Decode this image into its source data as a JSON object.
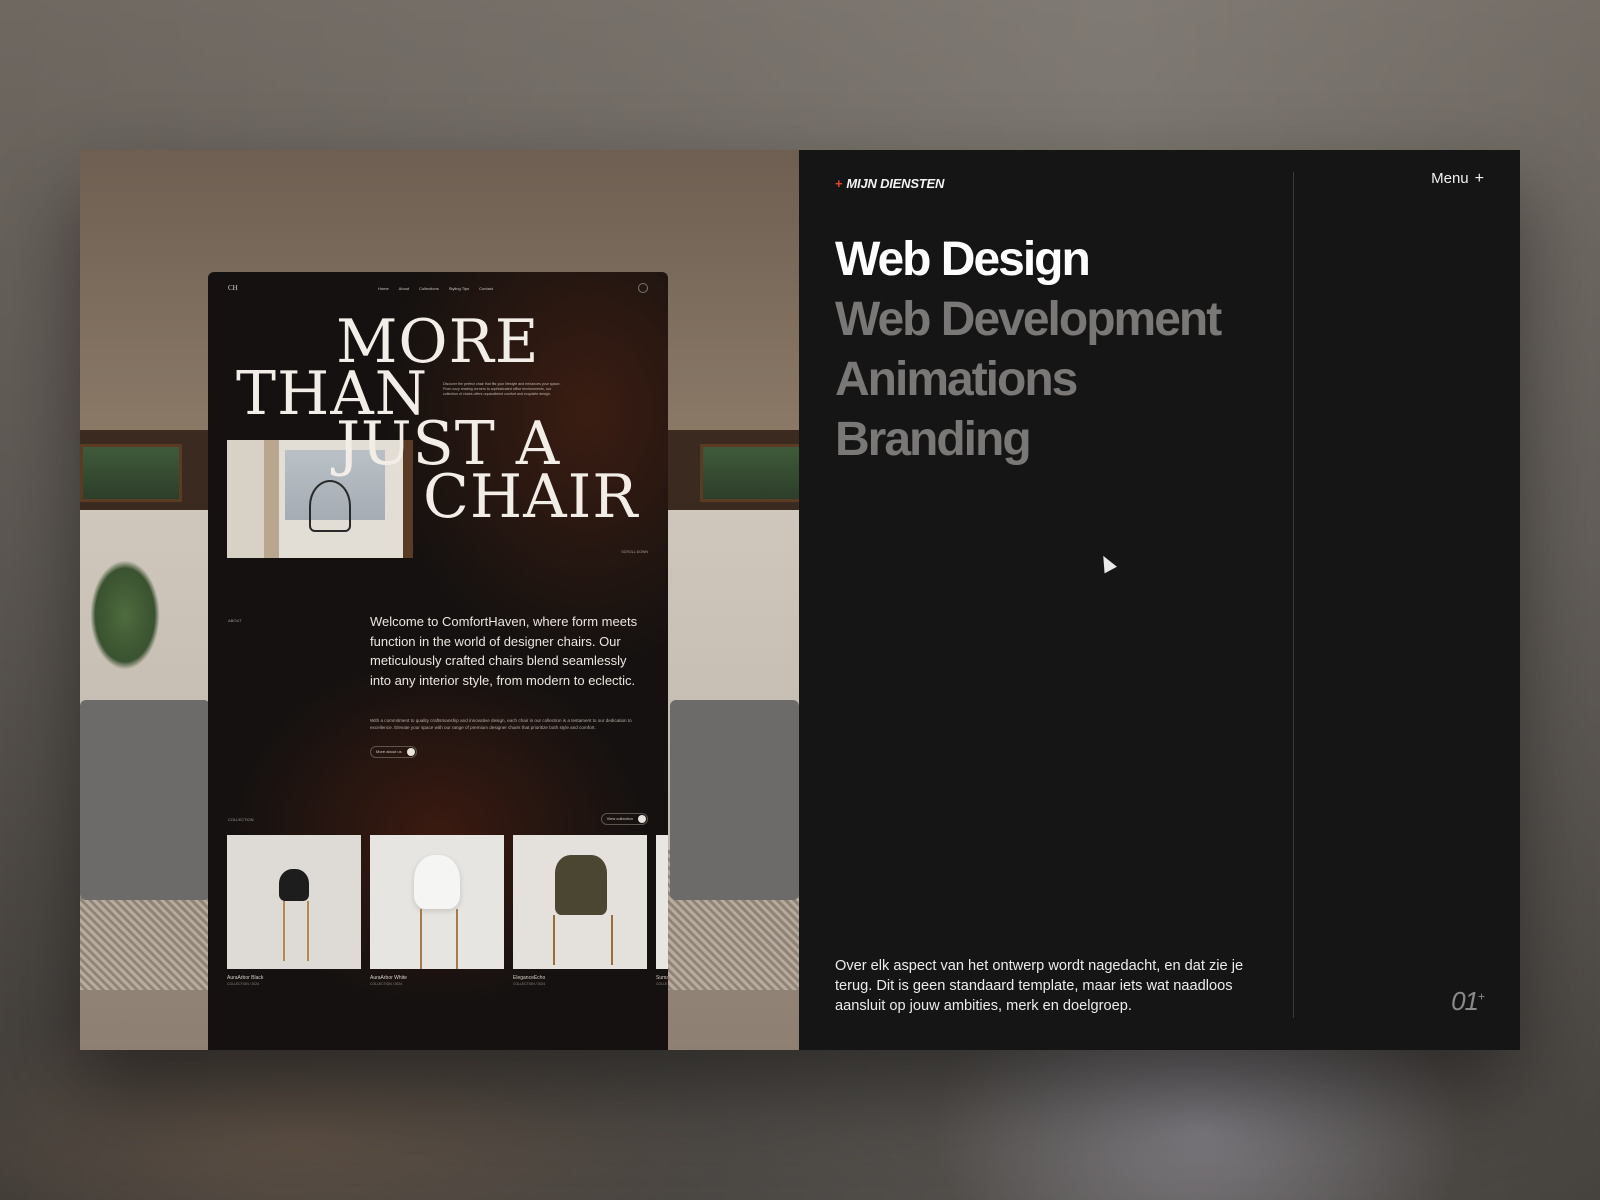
{
  "mockup": {
    "logo": "CH",
    "nav": [
      "Home",
      "About",
      "Collections",
      "Styling Tips",
      "Contact"
    ],
    "hero": {
      "line1": "MORE",
      "line2": "THAN",
      "line3": "JUST A",
      "line4": "CHAIR",
      "description": "Discover the perfect chair that fits your lifestyle and enhances your space. From cozy reading corners to sophisticated office environments, our collection of chairs offers unparalleled comfort and exquisite design.",
      "scroll": "SCROLL DOWN"
    },
    "about": {
      "tag": "ABOUT",
      "lead": "Welcome to ComfortHaven, where form meets function in the world of designer chairs. Our meticulously crafted chairs blend seamlessly into any interior style, from modern to eclectic.",
      "body": "With a commitment to quality craftsmanship and innovative design, each chair in our collection is a testament to our dedication to excellence. Elevate your space with our range of premium designer chairs that prioritize both style and comfort.",
      "button": "More about us"
    },
    "collection": {
      "tag": "COLLECTION",
      "button": "View collection",
      "items": [
        {
          "name": "AuraArbor Black",
          "sub": "COLLECTION / 2024"
        },
        {
          "name": "AuraArbor White",
          "sub": "COLLECTION / 2024"
        },
        {
          "name": "EleganceEcho",
          "sub": "COLLECTION / 2024"
        },
        {
          "name": "Suma",
          "sub": "COLLE"
        }
      ]
    }
  },
  "panel": {
    "tag": "MIJN DIENSTEN",
    "menu": "Menu",
    "services": [
      {
        "label": "Web Design",
        "active": true
      },
      {
        "label": "Web Development",
        "active": false
      },
      {
        "label": "Animations",
        "active": false
      },
      {
        "label": "Branding",
        "active": false
      }
    ],
    "description": "Over elk aspect van het ontwerp wordt nagedacht, en dat zie je terug. Dit is geen standaard template, maar iets wat naadloos aansluit op jouw ambities, merk en doelgroep.",
    "page_number": "01",
    "page_suffix": "+"
  },
  "colors": {
    "accent": "#e2462e",
    "panel_bg": "#151515",
    "mockup_bg": "#141110"
  },
  "icons": [
    "plus-icon",
    "search-icon",
    "arrow-icon",
    "cursor-icon"
  ]
}
